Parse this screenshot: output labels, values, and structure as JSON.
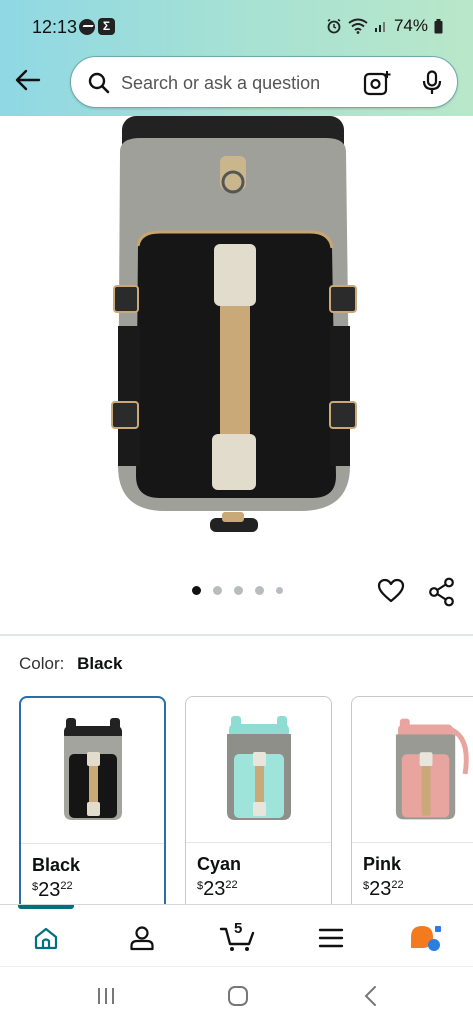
{
  "status_bar": {
    "time": "12:13",
    "battery": "74%"
  },
  "header": {
    "search_placeholder": "Search or ask a question"
  },
  "gallery": {
    "dot_count": 5,
    "active_dot": 0
  },
  "product": {
    "color_label": "Color:",
    "selected_color": "Black"
  },
  "swatches": [
    {
      "name": "Black",
      "currency": "$",
      "price_whole": "23",
      "price_fraction": "22",
      "selected": true
    },
    {
      "name": "Cyan",
      "currency": "$",
      "price_whole": "23",
      "price_fraction": "22",
      "selected": false
    },
    {
      "name": "Pink",
      "currency": "$",
      "price_whole": "23",
      "price_fraction": "22",
      "selected": false
    }
  ],
  "bottom_nav": {
    "cart_count": "5",
    "items": [
      "home-icon",
      "account-icon",
      "cart-icon",
      "menu-icon",
      "rufus-icon"
    ]
  },
  "colors": {
    "accent": "#00707f",
    "selected_border": "#2a6ea7",
    "rufus_orange": "#f47a20",
    "rufus_blue": "#2a7de1"
  }
}
